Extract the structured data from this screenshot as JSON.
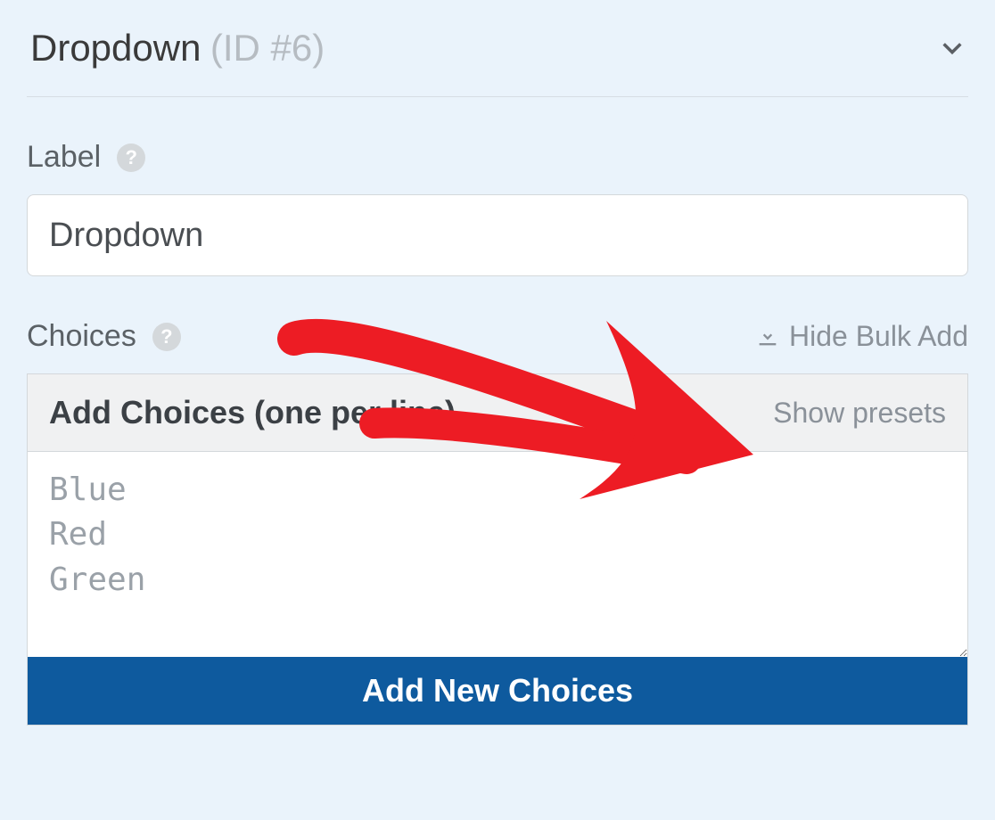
{
  "field": {
    "title": "Dropdown",
    "id_label": "(ID #6)"
  },
  "label": {
    "section_title": "Label",
    "value": "Dropdown"
  },
  "choices": {
    "section_title": "Choices",
    "bulk_toggle": "Hide Bulk Add",
    "header_title": "Add Choices (one per line)",
    "show_presets": "Show presets",
    "placeholder": "Blue\nRed\nGreen",
    "value": "",
    "add_button": "Add New Choices"
  }
}
